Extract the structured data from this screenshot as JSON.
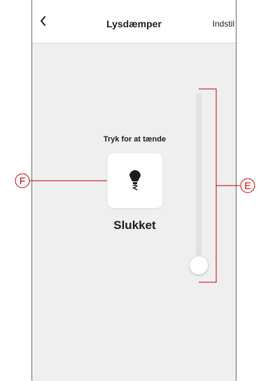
{
  "header": {
    "back_icon": "chevron-left-icon",
    "title": "Lysdæmper",
    "settings_label": "Indstil"
  },
  "main": {
    "hint": "Tryk for at tænde",
    "bulb_icon": "light-bulb-icon",
    "state": "Slukket"
  },
  "slider": {
    "level_percent": 0
  },
  "callouts": {
    "left_label": "F",
    "right_label": "E",
    "color": "#c00000"
  },
  "colors": {
    "background": "#efefef",
    "header": "#ffffff",
    "text": "#1d1d1d"
  }
}
